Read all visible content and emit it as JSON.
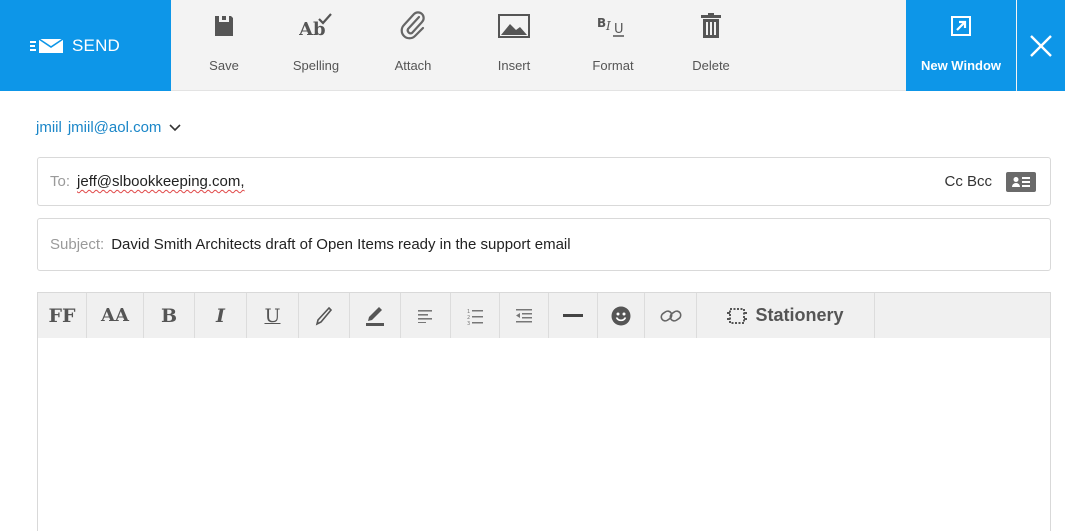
{
  "toolbar": {
    "send_label": "SEND",
    "tools": [
      {
        "label": "Save",
        "icon": "save-icon"
      },
      {
        "label": "Spelling",
        "icon": "spelling-icon"
      },
      {
        "label": "Attach",
        "icon": "paperclip-icon"
      },
      {
        "label": "Insert",
        "icon": "image-icon"
      },
      {
        "label": "Format",
        "icon": "format-text-icon"
      },
      {
        "label": "Delete",
        "icon": "trash-icon"
      }
    ],
    "new_window_label": "New Window",
    "accent_color": "#0d96e8"
  },
  "compose": {
    "from_name": "jmiil",
    "from_email": "jmiil@aol.com",
    "to_label": "To:",
    "to_value": "jeff@slbookkeeping.com,",
    "cc_bcc_label": "Cc Bcc",
    "subject_label": "Subject:",
    "subject_value": "David Smith Architects draft of Open Items ready in the support email"
  },
  "format_toolbar": {
    "font_label": "FF",
    "size_label": "AA",
    "bold_label": "B",
    "italic_label": "I",
    "underline_label": "U",
    "stationery_label": "Stationery"
  }
}
